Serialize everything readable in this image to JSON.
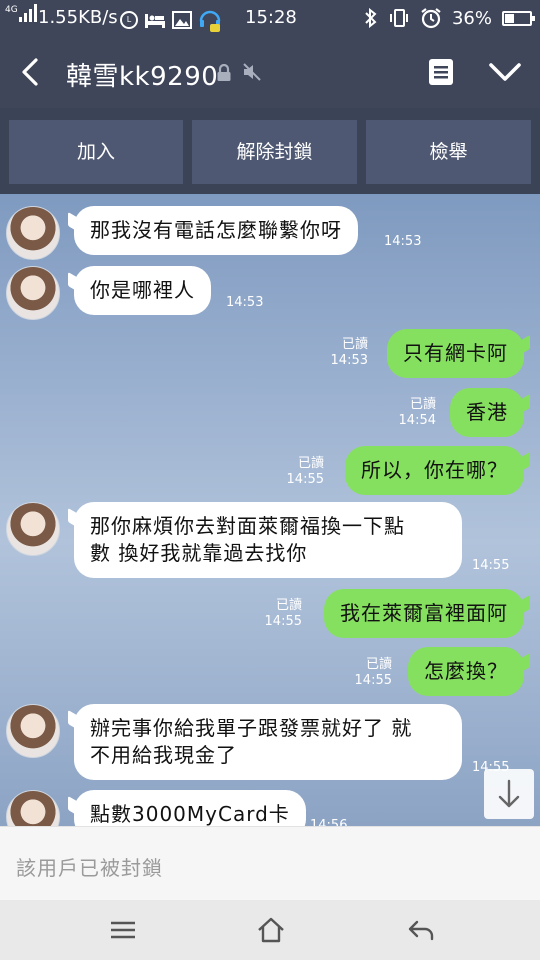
{
  "status_bar": {
    "network_tag": "4G",
    "speed": "1.55KB/s",
    "time": "15:28",
    "battery": "36%",
    "battery_level": 0.36,
    "icons": [
      "signal-icon",
      "line-icon",
      "bed-icon",
      "image-icon",
      "headset-icon",
      "bluetooth-icon",
      "vibrate-icon",
      "alarm-icon",
      "battery-icon"
    ]
  },
  "header": {
    "title": "韓雪kk9290"
  },
  "actions": {
    "join": "加入",
    "unblock": "解除封鎖",
    "report": "檢舉"
  },
  "messages": [
    {
      "side": "in",
      "lines": [
        "那我沒有電話怎麼聯繫你呀"
      ],
      "time": "14:53"
    },
    {
      "side": "in",
      "lines": [
        "你是哪裡人"
      ],
      "time": "14:53"
    },
    {
      "side": "out",
      "lines": [
        "只有網卡阿"
      ],
      "read": "已讀",
      "time": "14:53"
    },
    {
      "side": "out",
      "lines": [
        "香港"
      ],
      "read": "已讀",
      "time": "14:54"
    },
    {
      "side": "out",
      "lines": [
        "所以，你在哪？"
      ],
      "read": "已讀",
      "time": "14:55"
    },
    {
      "side": "in",
      "lines": [
        "那你麻煩你去對面萊爾福換一下點",
        "數 換好我就靠過去找你"
      ],
      "time": "14:55"
    },
    {
      "side": "out",
      "lines": [
        "我在萊爾富裡面阿"
      ],
      "read": "已讀",
      "time": "14:55"
    },
    {
      "side": "out",
      "lines": [
        "怎麼換？"
      ],
      "read": "已讀",
      "time": "14:55"
    },
    {
      "side": "in",
      "lines": [
        "辦完事你給我單子跟發票就好了 就",
        "不用給我現金了"
      ],
      "time": "14:55"
    },
    {
      "side": "in",
      "lines": [
        "點數3000MyCard卡"
      ],
      "time": "14:56"
    }
  ],
  "footer": {
    "blocked_text": "該用戶已被封鎖"
  },
  "colors": {
    "header_bg": "#3f4659",
    "outgoing_bubble": "#86e05f",
    "incoming_bubble": "#ffffff"
  }
}
